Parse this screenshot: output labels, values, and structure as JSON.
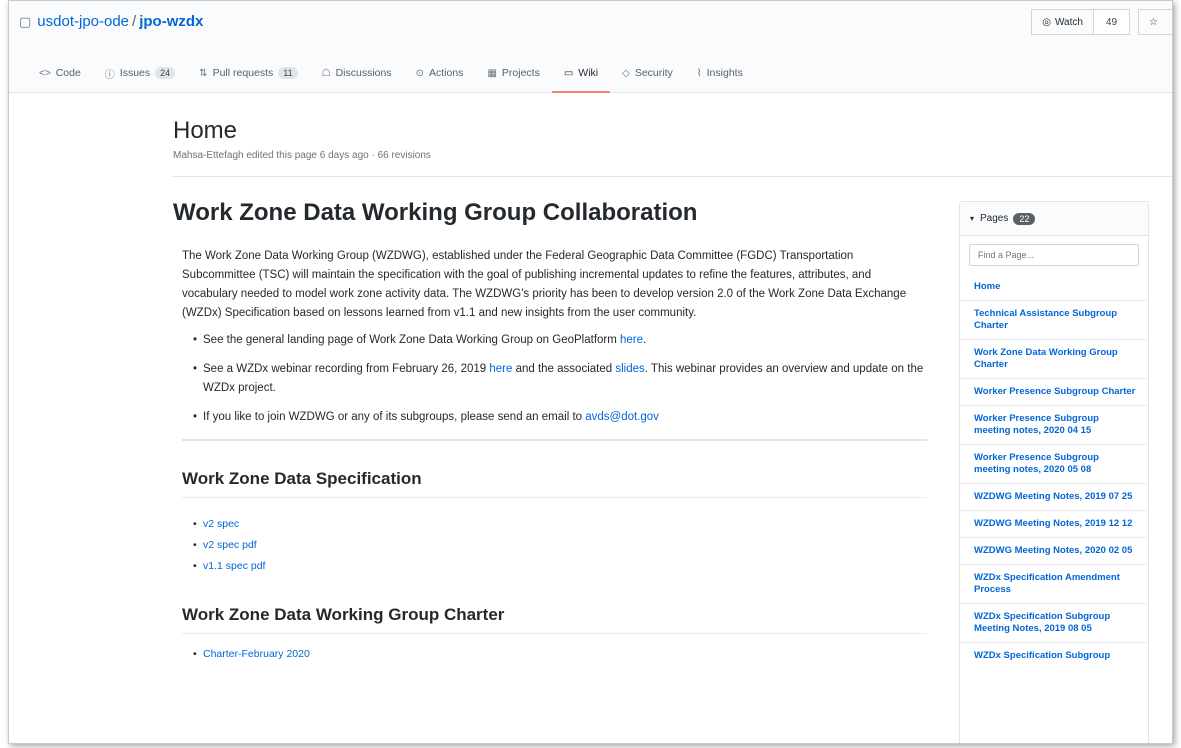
{
  "repo": {
    "owner": "usdot-jpo-ode",
    "separator": "/",
    "name": "jpo-wzdx",
    "watch_label": "Watch",
    "watch_count": "49"
  },
  "tabs": [
    {
      "label": "Code",
      "icon": "code-icon",
      "glyph": "<>",
      "count": ""
    },
    {
      "label": "Issues",
      "icon": "issue-icon",
      "glyph": "ⓘ",
      "count": "24"
    },
    {
      "label": "Pull requests",
      "icon": "pull-request-icon",
      "glyph": "⇅",
      "count": "11"
    },
    {
      "label": "Discussions",
      "icon": "discussions-icon",
      "glyph": "☖",
      "count": ""
    },
    {
      "label": "Actions",
      "icon": "actions-icon",
      "glyph": "⊙",
      "count": ""
    },
    {
      "label": "Projects",
      "icon": "projects-icon",
      "glyph": "▦",
      "count": ""
    },
    {
      "label": "Wiki",
      "icon": "wiki-icon",
      "glyph": "▭",
      "count": "",
      "active": true
    },
    {
      "label": "Security",
      "icon": "shield-icon",
      "glyph": "◇",
      "count": ""
    },
    {
      "label": "Insights",
      "icon": "graph-icon",
      "glyph": "⌇",
      "count": ""
    }
  ],
  "page": {
    "title": "Home",
    "meta": "Mahsa-Ettefagh edited this page 6 days ago · 66 revisions"
  },
  "content": {
    "heading": "Work Zone Data Working Group Collaboration",
    "intro": "The Work Zone Data Working Group (WZDWG), established under the Federal Geographic Data Committee (FGDC) Transportation Subcommittee (TSC) will maintain the specification with the goal of publishing incremental updates to refine the features, attributes, and vocabulary needed to model work zone activity data. The WZDWG's priority has been to develop version 2.0 of the Work Zone Data Exchange (WZDx) Specification based on lessons learned from v1.1 and new insights from the user community.",
    "bullet1": {
      "text": "See the general landing page of Work Zone Data Working Group on GeoPlatform ",
      "link": "here",
      "end": "."
    },
    "bullet2": {
      "text_a": "See a WZDx webinar recording from February 26, 2019 ",
      "link_a": "here",
      "text_b": " and the associated ",
      "link_b": "slides",
      "text_c": ". This webinar provides an overview and update on the WZDx project."
    },
    "bullet3": {
      "text": "If you like to join WZDWG or any of its subgroups, please send an email to ",
      "link": "avds@dot.gov"
    },
    "spec_heading": "Work Zone Data Specification",
    "spec_links": [
      "v2 spec",
      "v2 spec pdf",
      "v1.1 spec pdf"
    ],
    "charter_heading": "Work Zone Data Working Group Charter",
    "charter_links": [
      "Charter-February 2020"
    ]
  },
  "sidebar": {
    "label": "Pages",
    "count": "22",
    "search_placeholder": "Find a Page...",
    "pages": [
      "Home",
      "Technical Assistance Subgroup Charter",
      "Work Zone Data Working Group Charter",
      "Worker Presence Subgroup Charter",
      "Worker Presence Subgroup meeting notes, 2020 04 15",
      "Worker Presence Subgroup meeting notes, 2020 05 08",
      "WZDWG Meeting Notes, 2019 07 25",
      "WZDWG Meeting Notes, 2019 12 12",
      "WZDWG Meeting Notes, 2020 02 05",
      "WZDx Specification Amendment Process",
      "WZDx Specification Subgroup Meeting Notes, 2019 08 05",
      "WZDx Specification Subgroup"
    ]
  },
  "colors": {
    "link": "#0366d6",
    "active_tab_underline": "#f9826c"
  }
}
